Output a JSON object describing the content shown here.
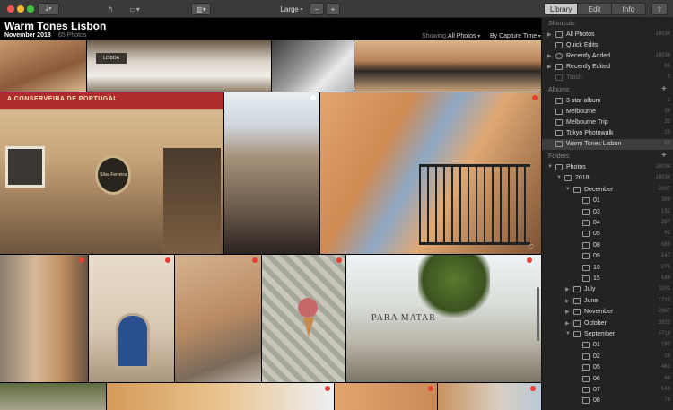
{
  "toolbar": {
    "zoom_label": "Large",
    "tabs": [
      "Library",
      "Edit",
      "Info"
    ],
    "active_tab": 0
  },
  "header": {
    "title": "Warm Tones Lisbon",
    "date": "November 2018",
    "count": "65 Photos",
    "showing_label": "Showing:",
    "showing_value": "All Photos",
    "sort_value": "By Capture Time"
  },
  "sidebar": {
    "shortcuts_title": "Shortcuts",
    "shortcuts": [
      {
        "label": "All Photos",
        "count": "18034"
      },
      {
        "label": "Quick Edits",
        "count": ""
      },
      {
        "label": "Recently Added",
        "count": "18036"
      },
      {
        "label": "Recently Edited",
        "count": "96"
      },
      {
        "label": "Trash",
        "count": "0"
      }
    ],
    "albums_title": "Albums",
    "albums": [
      {
        "label": "3 star album",
        "count": "1"
      },
      {
        "label": "Melbourne",
        "count": "36"
      },
      {
        "label": "Melbourne Trip",
        "count": "32"
      },
      {
        "label": "Tokyo Photowalk",
        "count": "29"
      },
      {
        "label": "Warm Tones Lisbon",
        "count": "65"
      }
    ],
    "folders_title": "Folders",
    "folders": [
      {
        "label": "Photos",
        "count": "18034",
        "depth": 0,
        "open": true
      },
      {
        "label": "2018",
        "count": "18034",
        "depth": 1,
        "open": true
      },
      {
        "label": "December",
        "count": "2097",
        "depth": 2,
        "open": true
      },
      {
        "label": "01",
        "count": "369",
        "depth": 3
      },
      {
        "label": "03",
        "count": "132",
        "depth": 3
      },
      {
        "label": "04",
        "count": "297",
        "depth": 3
      },
      {
        "label": "05",
        "count": "92",
        "depth": 3
      },
      {
        "label": "08",
        "count": "689",
        "depth": 3
      },
      {
        "label": "09",
        "count": "147",
        "depth": 3
      },
      {
        "label": "10",
        "count": "276",
        "depth": 3
      },
      {
        "label": "15",
        "count": "186",
        "depth": 3
      },
      {
        "label": "July",
        "count": "3201",
        "depth": 2
      },
      {
        "label": "June",
        "count": "1210",
        "depth": 2
      },
      {
        "label": "November",
        "count": "2867",
        "depth": 2
      },
      {
        "label": "October",
        "count": "3920",
        "depth": 2
      },
      {
        "label": "September",
        "count": "4718",
        "depth": 2,
        "open": true
      },
      {
        "label": "01",
        "count": "180",
        "depth": 3
      },
      {
        "label": "02",
        "count": "28",
        "depth": 3
      },
      {
        "label": "05",
        "count": "461",
        "depth": 3
      },
      {
        "label": "06",
        "count": "88",
        "depth": 3
      },
      {
        "label": "07",
        "count": "149",
        "depth": 3
      },
      {
        "label": "08",
        "count": "78",
        "depth": 3
      }
    ]
  },
  "photo_signs": {
    "shop": "A CONSERVEIRA DE PORTUGAL",
    "wall": "PARA MATAR",
    "card": "LISBOA",
    "plaque": "Silva Ferreira"
  },
  "colors": {
    "toolbar": "#3a3a3a",
    "sidebar": "#232323",
    "selection": "#3d3d3d",
    "flag": "#e83e35"
  }
}
